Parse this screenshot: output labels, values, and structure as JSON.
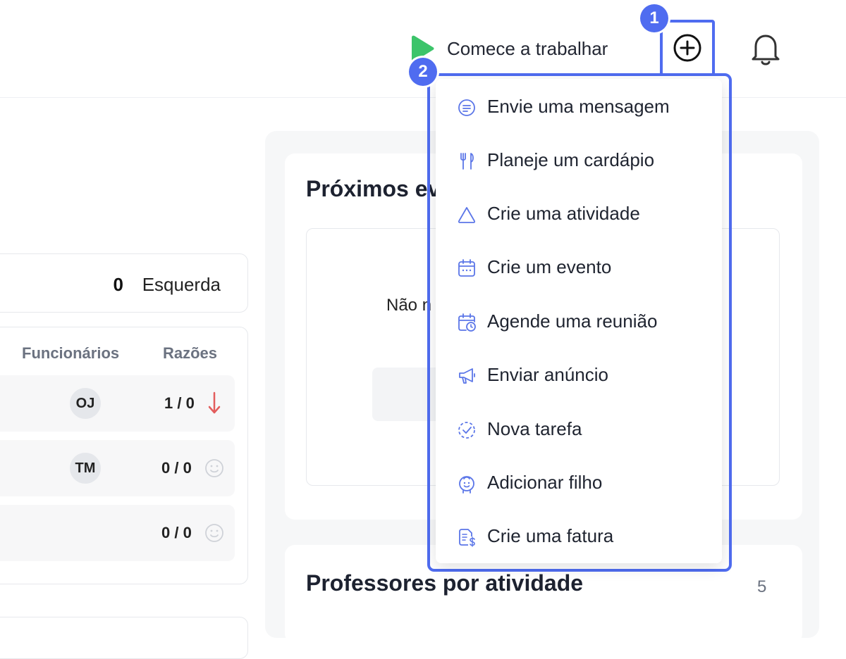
{
  "header": {
    "start_work_label": "Comece a trabalhar",
    "accent_color": "#4f6cf0",
    "brand_green": "#3cc46a"
  },
  "markers": {
    "one": "1",
    "two": "2"
  },
  "left": {
    "summary_count": "0",
    "summary_label": "Esquerda",
    "columns": [
      "Funcionários",
      "Razões"
    ],
    "rows": [
      {
        "avatar": "OJ",
        "ratio": "1 / 0",
        "indicator": "down-arrow-icon"
      },
      {
        "avatar": "TM",
        "ratio": "0 / 0",
        "indicator": "smiley-icon"
      },
      {
        "avatar": "",
        "ratio": "0 / 0",
        "indicator": "smiley-icon"
      }
    ]
  },
  "events": {
    "title_visible": "Próximos ev",
    "empty_text_visible": "Não n"
  },
  "teachers": {
    "title": "Professores por atividade",
    "count": "5"
  },
  "menu": {
    "items": [
      {
        "label": "Envie uma mensagem",
        "icon": "message-icon"
      },
      {
        "label": "Planeje um cardápio",
        "icon": "utensils-icon"
      },
      {
        "label": "Crie uma atividade",
        "icon": "triangle-icon"
      },
      {
        "label": "Crie um evento",
        "icon": "calendar-icon"
      },
      {
        "label": "Agende uma reunião",
        "icon": "calendar-clock-icon"
      },
      {
        "label": "Enviar anúncio",
        "icon": "megaphone-icon"
      },
      {
        "label": "Nova tarefa",
        "icon": "task-check-icon"
      },
      {
        "label": "Adicionar filho",
        "icon": "child-icon"
      },
      {
        "label": "Crie uma fatura",
        "icon": "invoice-icon"
      }
    ]
  }
}
